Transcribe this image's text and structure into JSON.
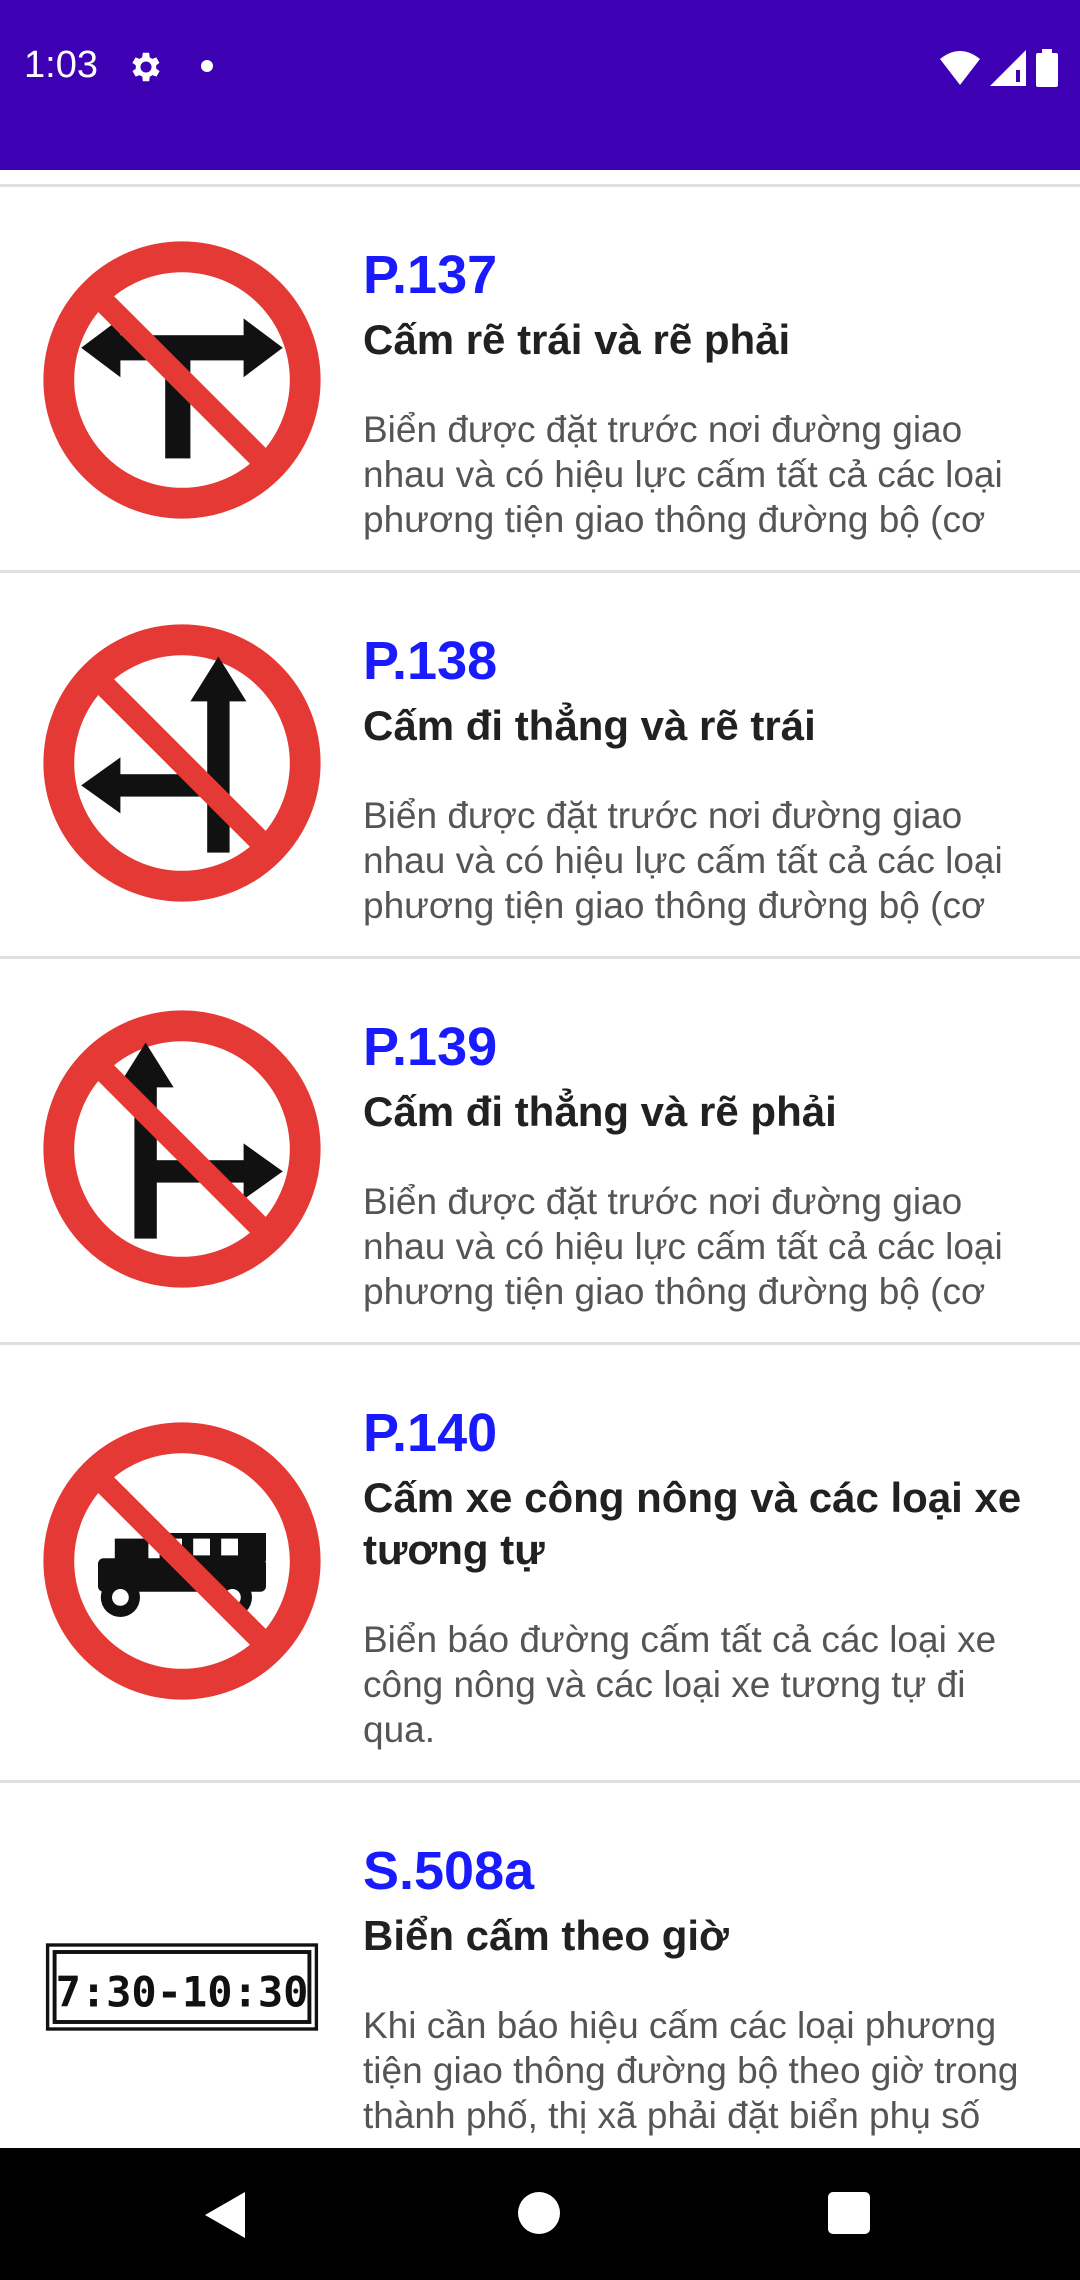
{
  "status_bar": {
    "time": "1:03",
    "bg_color": "#3d00b3"
  },
  "items": [
    {
      "code": "P.137",
      "name": "Cấm rẽ trái và rẽ phải",
      "desc": "Biển được đặt trước nơi đường giao nhau và có hiệu lực cấm tất cả các loại phương tiện giao thông đường bộ (cơ",
      "icon": "no-left-and-right-turn-sign-icon"
    },
    {
      "code": "P.138",
      "name": "Cấm đi thẳng và rẽ trái",
      "desc": "Biển được đặt trước nơi đường giao nhau và có hiệu lực cấm tất cả các loại phương tiện giao thông đường bộ (cơ",
      "icon": "no-straight-and-left-turn-sign-icon"
    },
    {
      "code": "P.139",
      "name": "Cấm đi thẳng và rẽ phải",
      "desc": "Biển được đặt trước nơi đường giao nhau và có hiệu lực cấm tất cả các loại phương tiện giao thông đường bộ (cơ",
      "icon": "no-straight-and-right-turn-sign-icon"
    },
    {
      "code": "P.140",
      "name": "Cấm xe công nông và các loại xe tương tự",
      "desc": "Biển báo đường cấm tất cả các loại xe công nông và các loại xe tương tự đi qua.",
      "icon": "no-farm-vehicle-sign-icon"
    },
    {
      "code": "S.508a",
      "name": "Biển cấm theo giờ",
      "desc": "Khi cần báo hiệu cấm các loại phương tiện giao thông đường bộ theo giờ trong thành phố, thị xã phải đặt biển phụ số",
      "icon": "time-restriction-sign-icon",
      "sign_text": "7:30-10:30"
    }
  ],
  "colors": {
    "code": "#1a1aff",
    "sign_red": "#e53935"
  }
}
